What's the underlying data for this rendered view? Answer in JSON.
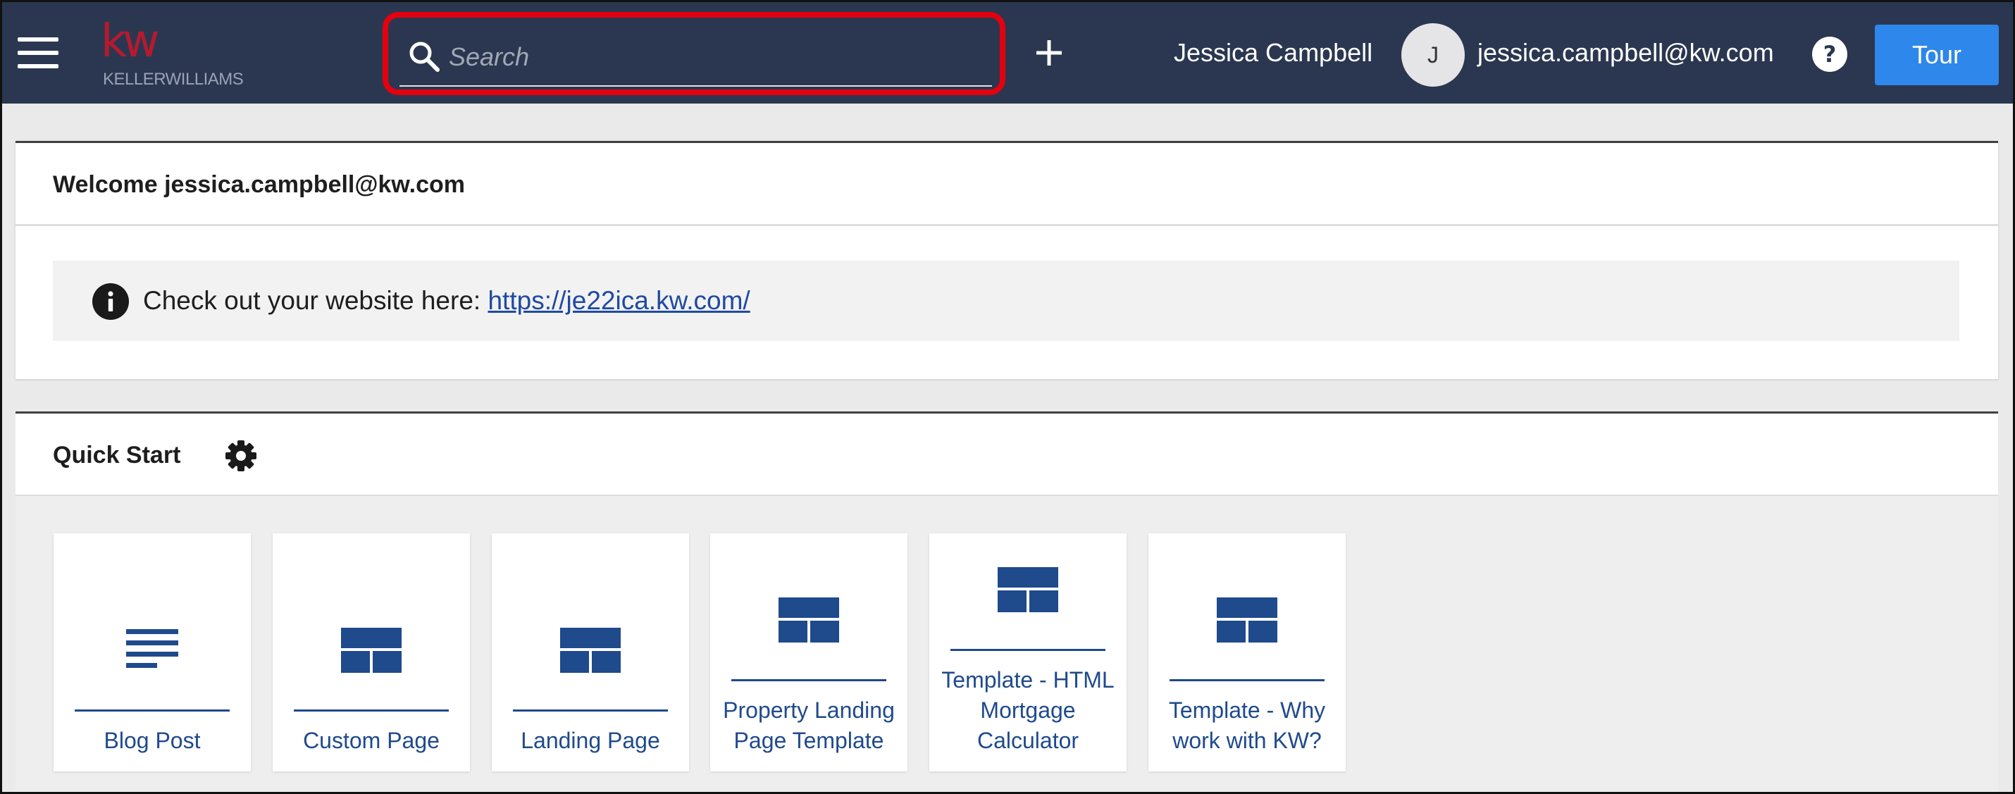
{
  "colors": {
    "topbar": "#2b3750",
    "accent": "#2e87ea",
    "brand": "#b61a2e",
    "highlight": "#e3000f",
    "link": "#1f4aa0",
    "tile_blue": "#1f4a8c"
  },
  "header": {
    "logo": {
      "mark": "kw",
      "wordmark": "KELLERWILLIAMS"
    },
    "menu_icon": "hamburger-icon",
    "search": {
      "placeholder": "Search",
      "value": "",
      "icon": "search-icon"
    },
    "add_icon": "plus-icon",
    "user_name": "Jessica Campbell",
    "avatar_initial": "J",
    "user_email": "jessica.campbell@kw.com",
    "help_icon": "question-circle-icon",
    "tour_label": "Tour"
  },
  "welcome": {
    "title": "Welcome jessica.campbell@kw.com",
    "notice_text": "Check out your website here: ",
    "notice_link": "https://je22ica.kw.com/",
    "notice_icon": "info-icon"
  },
  "quick_start": {
    "title": "Quick Start",
    "settings_icon": "gear-icon",
    "tiles": [
      {
        "label": "Blog Post",
        "icon": "text-lines-icon"
      },
      {
        "label": "Custom Page",
        "icon": "layout-icon"
      },
      {
        "label": "Landing Page",
        "icon": "layout-icon"
      },
      {
        "label": "Property Landing Page Template",
        "icon": "layout-icon"
      },
      {
        "label": "Template - HTML Mortgage Calculator",
        "icon": "layout-icon"
      },
      {
        "label": "Template - Why work with KW?",
        "icon": "layout-icon"
      }
    ]
  }
}
